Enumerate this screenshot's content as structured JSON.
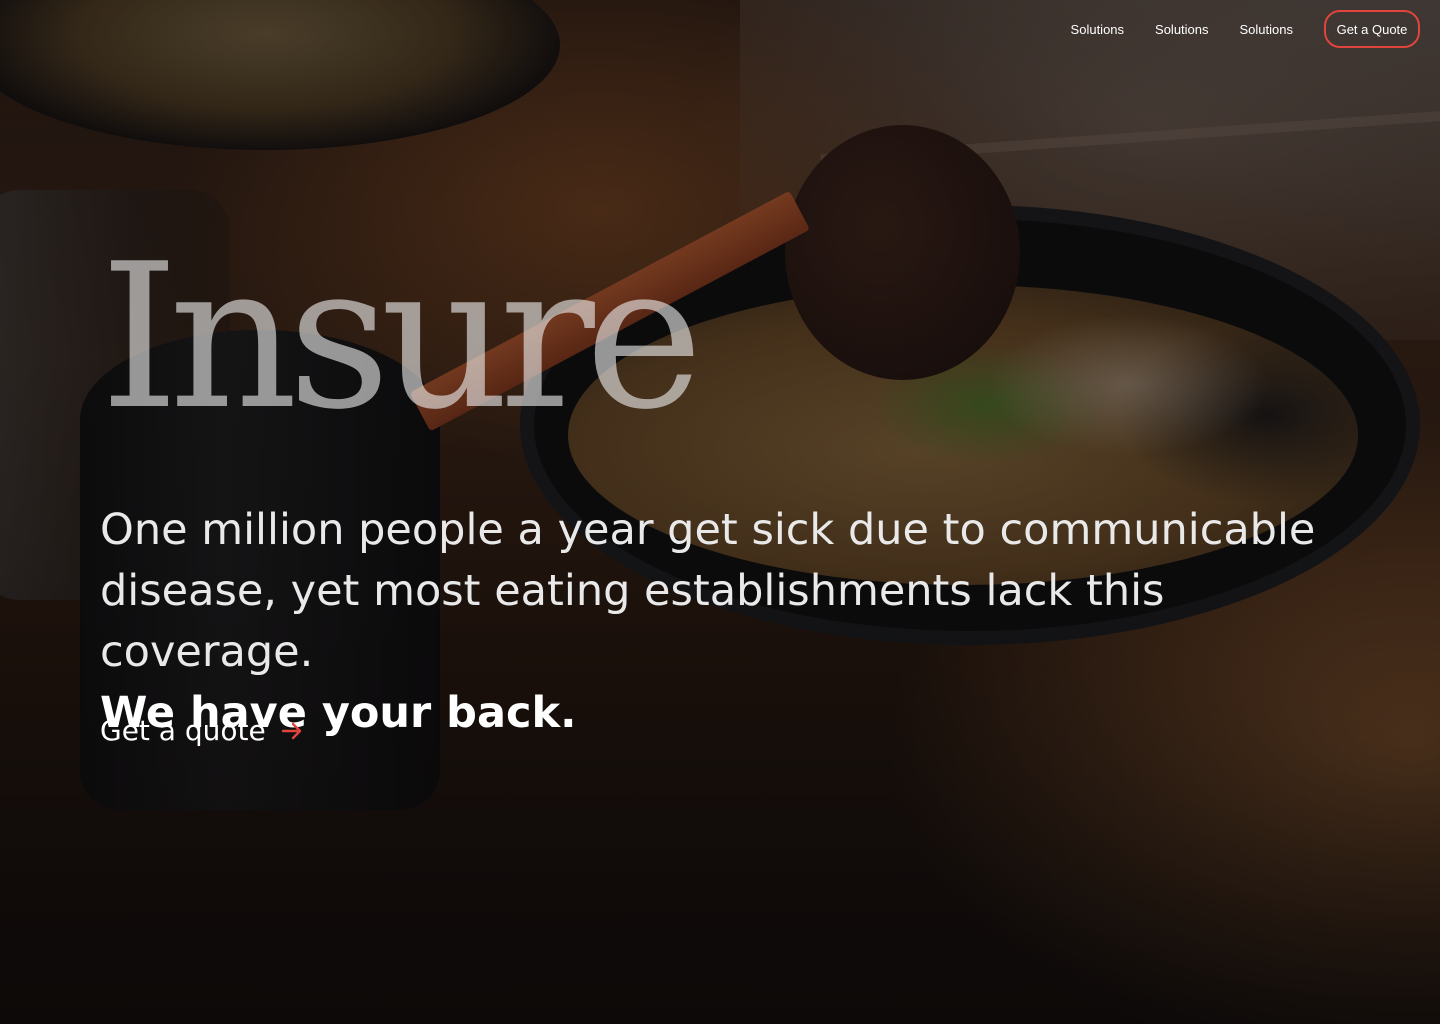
{
  "nav": {
    "items": [
      {
        "label": "Solutions"
      },
      {
        "label": "Solutions"
      },
      {
        "label": "Solutions"
      }
    ],
    "cta_label": "Get a Quote"
  },
  "hero": {
    "brand": "Insure",
    "tagline": "One million people a year get sick due to communicable disease, yet most eating establishments lack this coverage.",
    "emphasis": "We have your back.",
    "quote_link_label": "Get a quote",
    "quote_link_icon": "arrow-right-icon"
  },
  "colors": {
    "accent": "#e0443c",
    "text": "#ffffff"
  }
}
